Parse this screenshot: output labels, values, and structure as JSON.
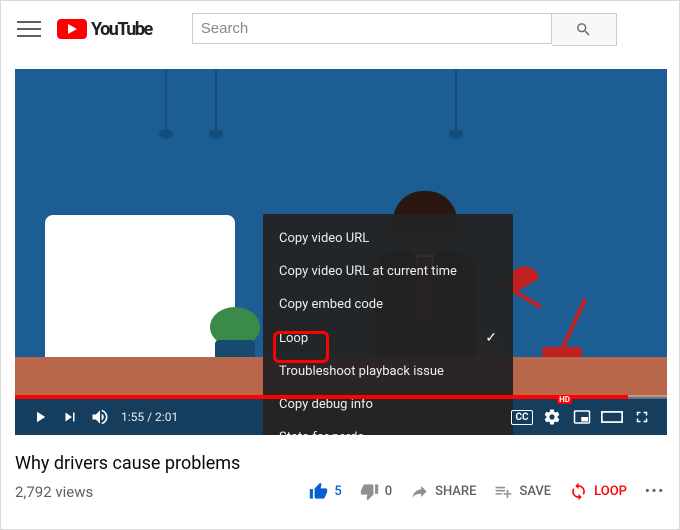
{
  "header": {
    "logo": "YouTube",
    "search_placeholder": "Search"
  },
  "context_menu": {
    "items": [
      {
        "label": "Copy video URL"
      },
      {
        "label": "Copy video URL at current time"
      },
      {
        "label": "Copy embed code"
      },
      {
        "label": "Loop",
        "checked": true
      },
      {
        "label": "Troubleshoot playback issue"
      },
      {
        "label": "Copy debug info"
      },
      {
        "label": "Stats for nerds"
      }
    ]
  },
  "player": {
    "time_current": "1:55",
    "time_total": "2:01",
    "cc": "CC",
    "hd": "HD"
  },
  "video": {
    "title": "Why drivers cause problems",
    "views": "2,792 views"
  },
  "actions": {
    "likes": "5",
    "dislikes": "0",
    "share": "SHARE",
    "save": "SAVE",
    "loop": "LOOP"
  }
}
